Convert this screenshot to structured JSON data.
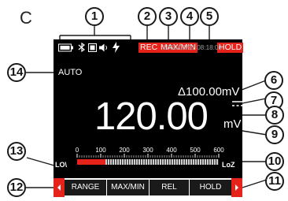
{
  "panel_label": "C",
  "callouts": [
    "1",
    "2",
    "3",
    "4",
    "5",
    "6",
    "7",
    "8",
    "9",
    "10",
    "11",
    "12",
    "13",
    "14"
  ],
  "status": {
    "rec": "REC",
    "maxmin": "MAX/MIN",
    "hold": "HOLD",
    "datetime": "2000/01/01 08:18:00"
  },
  "mode": "AUTO",
  "relative": {
    "symbol": "Δ",
    "value": "100.00mV"
  },
  "reading": {
    "value": "120.00",
    "unit": "mV"
  },
  "bargraph": {
    "ticks": [
      "0",
      "100",
      "200",
      "300",
      "400",
      "500",
      "600"
    ],
    "fill_fraction": 0.2,
    "left_label": "LO\\",
    "right_label": "LoZ"
  },
  "softkeys": [
    "RANGE",
    "MAX/MIN",
    "REL",
    "HOLD"
  ],
  "colors": {
    "accent": "#e5231b",
    "screen": "#000000",
    "text": "#ffffff"
  },
  "icons": [
    "battery-icon",
    "bluetooth-icon",
    "memory-icon",
    "speaker-icon",
    "lightning-icon",
    "dc-symbol-icon",
    "arrow-left-icon",
    "arrow-right-icon"
  ]
}
